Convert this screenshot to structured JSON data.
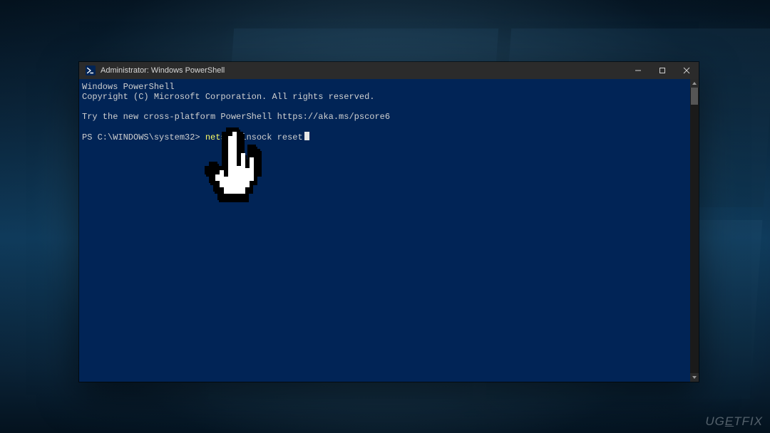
{
  "window": {
    "title": "Administrator: Windows PowerShell",
    "icon_name": "powershell-icon"
  },
  "controls": {
    "minimize": "Minimize",
    "maximize": "Maximize",
    "close": "Close"
  },
  "console": {
    "line1": "Windows PowerShell",
    "line2": "Copyright (C) Microsoft Corporation. All rights reserved.",
    "line3": "Try the new cross-platform PowerShell https://aka.ms/pscore6",
    "prompt": "PS C:\\WINDOWS\\system32> ",
    "cmd_part1": "netsh",
    "cmd_part2": " Winsock reset"
  },
  "watermark": "UGETFIX"
}
